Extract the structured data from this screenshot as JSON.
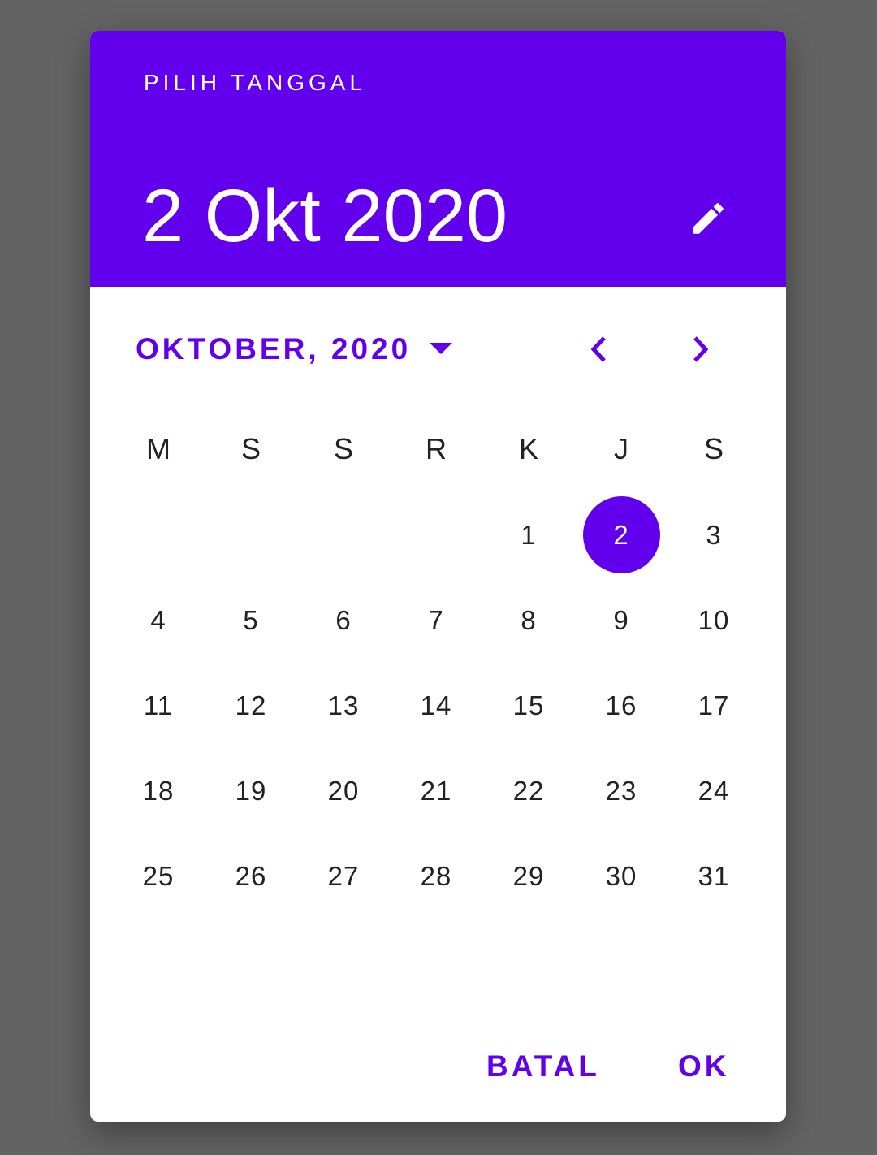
{
  "header": {
    "title": "PILIH TANGGAL",
    "selected_date": "2 Okt 2020",
    "edit_icon": "pencil-icon"
  },
  "calendar": {
    "month_label": "OKTOBER, 2020",
    "dropdown_icon": "caret-down-icon",
    "prev_icon": "chevron-left-icon",
    "next_icon": "chevron-right-icon",
    "weekdays": [
      "M",
      "S",
      "S",
      "R",
      "K",
      "J",
      "S"
    ],
    "leading_blanks": 4,
    "days": [
      "1",
      "2",
      "3",
      "4",
      "5",
      "6",
      "7",
      "8",
      "9",
      "10",
      "11",
      "12",
      "13",
      "14",
      "15",
      "16",
      "17",
      "18",
      "19",
      "20",
      "21",
      "22",
      "23",
      "24",
      "25",
      "26",
      "27",
      "28",
      "29",
      "30",
      "31"
    ],
    "selected_day": "2"
  },
  "actions": {
    "cancel_label": "BATAL",
    "ok_label": "OK"
  },
  "colors": {
    "accent": "#6200ee",
    "scrim": "#636363",
    "surface": "#ffffff",
    "text": "#222222"
  }
}
